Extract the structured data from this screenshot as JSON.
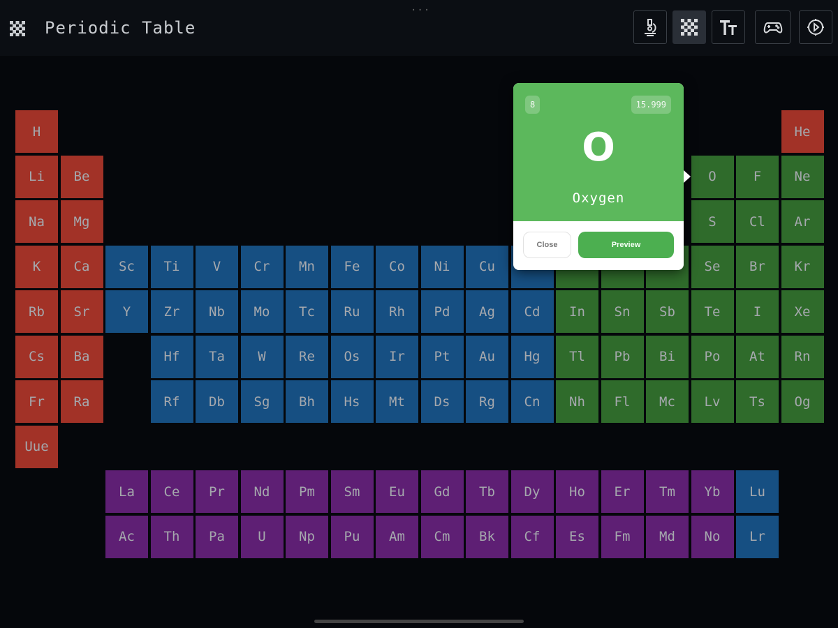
{
  "app": {
    "title": "Periodic Table",
    "icon": "grid-dots-icon",
    "grabber": "..."
  },
  "toolbar": [
    {
      "name": "microscope-button",
      "icon": "microscope-icon",
      "active": false
    },
    {
      "name": "grid-view-button",
      "icon": "grid-dots-icon",
      "active": true
    },
    {
      "name": "text-size-button",
      "icon": "text-size-icon",
      "active": false
    },
    {
      "name": "game-button",
      "icon": "gamepad-icon",
      "active": false
    },
    {
      "name": "settings-button",
      "icon": "gear-icon",
      "active": false
    }
  ],
  "colors": {
    "red": "#a23227",
    "blue": "#164f82",
    "green": "#2f6b2b",
    "purple": "#5e1f74",
    "popover_accent": "#5cb85c"
  },
  "elements": [
    {
      "s": "H",
      "col": 1,
      "row": 1,
      "c": "red"
    },
    {
      "s": "He",
      "col": 18,
      "row": 1,
      "c": "red"
    },
    {
      "s": "Li",
      "col": 1,
      "row": 2,
      "c": "red"
    },
    {
      "s": "Be",
      "col": 2,
      "row": 2,
      "c": "red"
    },
    {
      "s": "O",
      "col": 16,
      "row": 2,
      "c": "green"
    },
    {
      "s": "F",
      "col": 17,
      "row": 2,
      "c": "green"
    },
    {
      "s": "Ne",
      "col": 18,
      "row": 2,
      "c": "green"
    },
    {
      "s": "Na",
      "col": 1,
      "row": 3,
      "c": "red"
    },
    {
      "s": "Mg",
      "col": 2,
      "row": 3,
      "c": "red"
    },
    {
      "s": "S",
      "col": 16,
      "row": 3,
      "c": "green"
    },
    {
      "s": "Cl",
      "col": 17,
      "row": 3,
      "c": "green"
    },
    {
      "s": "Ar",
      "col": 18,
      "row": 3,
      "c": "green"
    },
    {
      "s": "K",
      "col": 1,
      "row": 4,
      "c": "red"
    },
    {
      "s": "Ca",
      "col": 2,
      "row": 4,
      "c": "red"
    },
    {
      "s": "Sc",
      "col": 3,
      "row": 4,
      "c": "blue"
    },
    {
      "s": "Ti",
      "col": 4,
      "row": 4,
      "c": "blue"
    },
    {
      "s": "V",
      "col": 5,
      "row": 4,
      "c": "blue"
    },
    {
      "s": "Cr",
      "col": 6,
      "row": 4,
      "c": "blue"
    },
    {
      "s": "Mn",
      "col": 7,
      "row": 4,
      "c": "blue"
    },
    {
      "s": "Fe",
      "col": 8,
      "row": 4,
      "c": "blue"
    },
    {
      "s": "Co",
      "col": 9,
      "row": 4,
      "c": "blue"
    },
    {
      "s": "Ni",
      "col": 10,
      "row": 4,
      "c": "blue"
    },
    {
      "s": "Cu",
      "col": 11,
      "row": 4,
      "c": "blue"
    },
    {
      "s": "",
      "col": 12,
      "row": 4,
      "c": "blue"
    },
    {
      "s": "",
      "col": 13,
      "row": 4,
      "c": "green"
    },
    {
      "s": "",
      "col": 14,
      "row": 4,
      "c": "green"
    },
    {
      "s": "",
      "col": 15,
      "row": 4,
      "c": "green"
    },
    {
      "s": "Se",
      "col": 16,
      "row": 4,
      "c": "green"
    },
    {
      "s": "Br",
      "col": 17,
      "row": 4,
      "c": "green"
    },
    {
      "s": "Kr",
      "col": 18,
      "row": 4,
      "c": "green"
    },
    {
      "s": "Rb",
      "col": 1,
      "row": 5,
      "c": "red"
    },
    {
      "s": "Sr",
      "col": 2,
      "row": 5,
      "c": "red"
    },
    {
      "s": "Y",
      "col": 3,
      "row": 5,
      "c": "blue"
    },
    {
      "s": "Zr",
      "col": 4,
      "row": 5,
      "c": "blue"
    },
    {
      "s": "Nb",
      "col": 5,
      "row": 5,
      "c": "blue"
    },
    {
      "s": "Mo",
      "col": 6,
      "row": 5,
      "c": "blue"
    },
    {
      "s": "Tc",
      "col": 7,
      "row": 5,
      "c": "blue"
    },
    {
      "s": "Ru",
      "col": 8,
      "row": 5,
      "c": "blue"
    },
    {
      "s": "Rh",
      "col": 9,
      "row": 5,
      "c": "blue"
    },
    {
      "s": "Pd",
      "col": 10,
      "row": 5,
      "c": "blue"
    },
    {
      "s": "Ag",
      "col": 11,
      "row": 5,
      "c": "blue"
    },
    {
      "s": "Cd",
      "col": 12,
      "row": 5,
      "c": "blue"
    },
    {
      "s": "In",
      "col": 13,
      "row": 5,
      "c": "green"
    },
    {
      "s": "Sn",
      "col": 14,
      "row": 5,
      "c": "green"
    },
    {
      "s": "Sb",
      "col": 15,
      "row": 5,
      "c": "green"
    },
    {
      "s": "Te",
      "col": 16,
      "row": 5,
      "c": "green"
    },
    {
      "s": "I",
      "col": 17,
      "row": 5,
      "c": "green"
    },
    {
      "s": "Xe",
      "col": 18,
      "row": 5,
      "c": "green"
    },
    {
      "s": "Cs",
      "col": 1,
      "row": 6,
      "c": "red"
    },
    {
      "s": "Ba",
      "col": 2,
      "row": 6,
      "c": "red"
    },
    {
      "s": "Hf",
      "col": 4,
      "row": 6,
      "c": "blue"
    },
    {
      "s": "Ta",
      "col": 5,
      "row": 6,
      "c": "blue"
    },
    {
      "s": "W",
      "col": 6,
      "row": 6,
      "c": "blue"
    },
    {
      "s": "Re",
      "col": 7,
      "row": 6,
      "c": "blue"
    },
    {
      "s": "Os",
      "col": 8,
      "row": 6,
      "c": "blue"
    },
    {
      "s": "Ir",
      "col": 9,
      "row": 6,
      "c": "blue"
    },
    {
      "s": "Pt",
      "col": 10,
      "row": 6,
      "c": "blue"
    },
    {
      "s": "Au",
      "col": 11,
      "row": 6,
      "c": "blue"
    },
    {
      "s": "Hg",
      "col": 12,
      "row": 6,
      "c": "blue"
    },
    {
      "s": "Tl",
      "col": 13,
      "row": 6,
      "c": "green"
    },
    {
      "s": "Pb",
      "col": 14,
      "row": 6,
      "c": "green"
    },
    {
      "s": "Bi",
      "col": 15,
      "row": 6,
      "c": "green"
    },
    {
      "s": "Po",
      "col": 16,
      "row": 6,
      "c": "green"
    },
    {
      "s": "At",
      "col": 17,
      "row": 6,
      "c": "green"
    },
    {
      "s": "Rn",
      "col": 18,
      "row": 6,
      "c": "green"
    },
    {
      "s": "Fr",
      "col": 1,
      "row": 7,
      "c": "red"
    },
    {
      "s": "Ra",
      "col": 2,
      "row": 7,
      "c": "red"
    },
    {
      "s": "Rf",
      "col": 4,
      "row": 7,
      "c": "blue"
    },
    {
      "s": "Db",
      "col": 5,
      "row": 7,
      "c": "blue"
    },
    {
      "s": "Sg",
      "col": 6,
      "row": 7,
      "c": "blue"
    },
    {
      "s": "Bh",
      "col": 7,
      "row": 7,
      "c": "blue"
    },
    {
      "s": "Hs",
      "col": 8,
      "row": 7,
      "c": "blue"
    },
    {
      "s": "Mt",
      "col": 9,
      "row": 7,
      "c": "blue"
    },
    {
      "s": "Ds",
      "col": 10,
      "row": 7,
      "c": "blue"
    },
    {
      "s": "Rg",
      "col": 11,
      "row": 7,
      "c": "blue"
    },
    {
      "s": "Cn",
      "col": 12,
      "row": 7,
      "c": "blue"
    },
    {
      "s": "Nh",
      "col": 13,
      "row": 7,
      "c": "green"
    },
    {
      "s": "Fl",
      "col": 14,
      "row": 7,
      "c": "green"
    },
    {
      "s": "Mc",
      "col": 15,
      "row": 7,
      "c": "green"
    },
    {
      "s": "Lv",
      "col": 16,
      "row": 7,
      "c": "green"
    },
    {
      "s": "Ts",
      "col": 17,
      "row": 7,
      "c": "green"
    },
    {
      "s": "Og",
      "col": 18,
      "row": 7,
      "c": "green"
    },
    {
      "s": "Uue",
      "col": 1,
      "row": 8,
      "c": "red"
    },
    {
      "s": "La",
      "col": 3,
      "row": 9,
      "c": "purple"
    },
    {
      "s": "Ce",
      "col": 4,
      "row": 9,
      "c": "purple"
    },
    {
      "s": "Pr",
      "col": 5,
      "row": 9,
      "c": "purple"
    },
    {
      "s": "Nd",
      "col": 6,
      "row": 9,
      "c": "purple"
    },
    {
      "s": "Pm",
      "col": 7,
      "row": 9,
      "c": "purple"
    },
    {
      "s": "Sm",
      "col": 8,
      "row": 9,
      "c": "purple"
    },
    {
      "s": "Eu",
      "col": 9,
      "row": 9,
      "c": "purple"
    },
    {
      "s": "Gd",
      "col": 10,
      "row": 9,
      "c": "purple"
    },
    {
      "s": "Tb",
      "col": 11,
      "row": 9,
      "c": "purple"
    },
    {
      "s": "Dy",
      "col": 12,
      "row": 9,
      "c": "purple"
    },
    {
      "s": "Ho",
      "col": 13,
      "row": 9,
      "c": "purple"
    },
    {
      "s": "Er",
      "col": 14,
      "row": 9,
      "c": "purple"
    },
    {
      "s": "Tm",
      "col": 15,
      "row": 9,
      "c": "purple"
    },
    {
      "s": "Yb",
      "col": 16,
      "row": 9,
      "c": "purple"
    },
    {
      "s": "Lu",
      "col": 17,
      "row": 9,
      "c": "blue"
    },
    {
      "s": "Ac",
      "col": 3,
      "row": 10,
      "c": "purple"
    },
    {
      "s": "Th",
      "col": 4,
      "row": 10,
      "c": "purple"
    },
    {
      "s": "Pa",
      "col": 5,
      "row": 10,
      "c": "purple"
    },
    {
      "s": "U",
      "col": 6,
      "row": 10,
      "c": "purple"
    },
    {
      "s": "Np",
      "col": 7,
      "row": 10,
      "c": "purple"
    },
    {
      "s": "Pu",
      "col": 8,
      "row": 10,
      "c": "purple"
    },
    {
      "s": "Am",
      "col": 9,
      "row": 10,
      "c": "purple"
    },
    {
      "s": "Cm",
      "col": 10,
      "row": 10,
      "c": "purple"
    },
    {
      "s": "Bk",
      "col": 11,
      "row": 10,
      "c": "purple"
    },
    {
      "s": "Cf",
      "col": 12,
      "row": 10,
      "c": "purple"
    },
    {
      "s": "Es",
      "col": 13,
      "row": 10,
      "c": "purple"
    },
    {
      "s": "Fm",
      "col": 14,
      "row": 10,
      "c": "purple"
    },
    {
      "s": "Md",
      "col": 15,
      "row": 10,
      "c": "purple"
    },
    {
      "s": "No",
      "col": 16,
      "row": 10,
      "c": "purple"
    },
    {
      "s": "Lr",
      "col": 17,
      "row": 10,
      "c": "blue"
    }
  ],
  "popover": {
    "atomic_number": "8",
    "atomic_mass": "15.999",
    "symbol": "O",
    "name": "Oxygen",
    "close_label": "Close",
    "preview_label": "Preview"
  }
}
